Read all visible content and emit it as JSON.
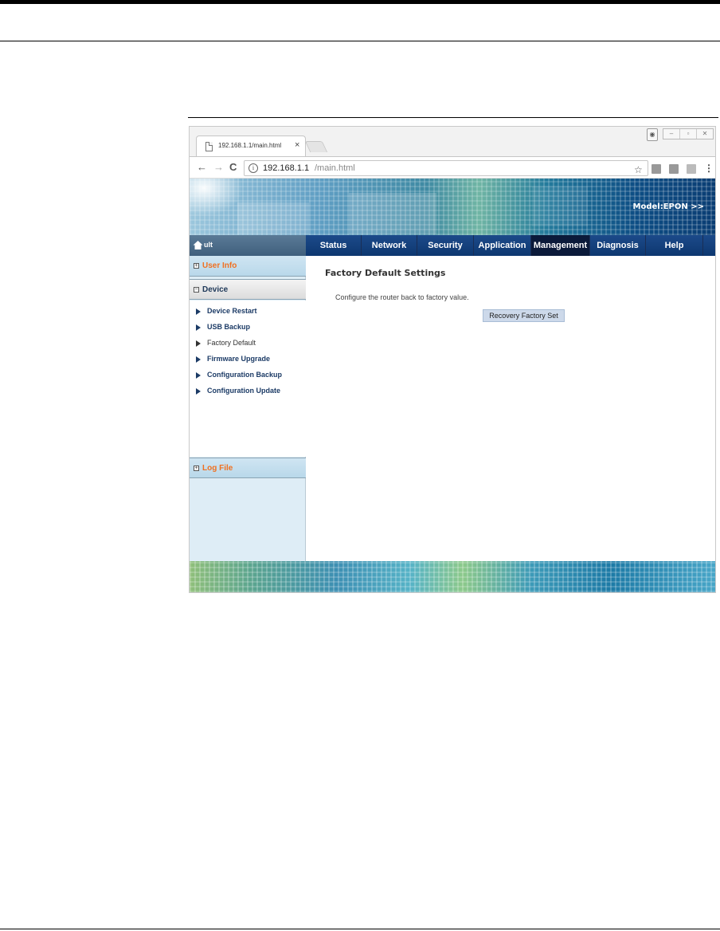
{
  "browser": {
    "tab_title": "192.168.1.1/main.html",
    "tab_close": "×",
    "url_host": "192.168.1.1",
    "url_path": "/main.html",
    "nav": {
      "back": "←",
      "forward": "→",
      "reload": "C"
    },
    "star": "☆",
    "menu": "⋮",
    "win_controls": [
      "–",
      "▫",
      "✕"
    ]
  },
  "banner": {
    "model_label": "Model:EPON >>"
  },
  "sidebar": {
    "user_label": "ult",
    "sections": {
      "user_info": "User Info",
      "device": "Device",
      "log_file": "Log File"
    },
    "device_items": [
      {
        "label": "Device Restart"
      },
      {
        "label": "USB Backup"
      },
      {
        "label": "Factory Default"
      },
      {
        "label": "Firmware Upgrade"
      },
      {
        "label": "Configuration Backup"
      },
      {
        "label": "Configuration Update"
      }
    ]
  },
  "topnav": {
    "items": [
      "Status",
      "Network",
      "Security",
      "Application",
      "Management",
      "Diagnosis",
      "Help"
    ],
    "active": "Management"
  },
  "content": {
    "title": "Factory Default Settings",
    "description": "Configure the router back to factory value.",
    "button_label": "Recovery Factory Set"
  }
}
